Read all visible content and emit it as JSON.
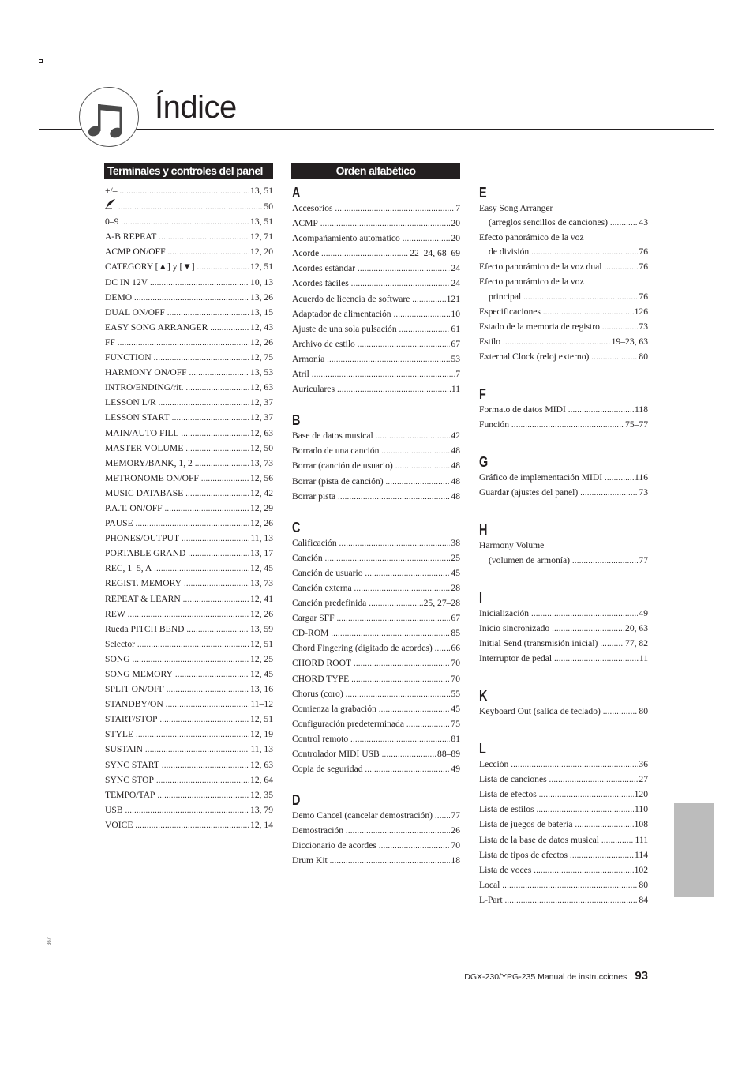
{
  "header": {
    "title": "Índice",
    "icon": "music-note-icon"
  },
  "panel_section": {
    "heading": "Terminales y controles del panel",
    "entries": [
      {
        "term": "+/–",
        "pages": "13, 51"
      },
      {
        "term": "",
        "icon": "quill-pen-icon",
        "pages": "50"
      },
      {
        "term": "0–9",
        "pages": "13, 51"
      },
      {
        "term": "A-B REPEAT",
        "pages": "12, 71"
      },
      {
        "term": "ACMP ON/OFF",
        "pages": "12, 20"
      },
      {
        "term": "CATEGORY [▲] y [▼]",
        "pages": "12, 51"
      },
      {
        "term": "DC IN 12V",
        "pages": "10, 13"
      },
      {
        "term": "DEMO",
        "pages": "13, 26"
      },
      {
        "term": "DUAL ON/OFF",
        "pages": "13, 15"
      },
      {
        "term": "EASY SONG ARRANGER",
        "pages": "12, 43"
      },
      {
        "term": "FF",
        "pages": "12, 26"
      },
      {
        "term": "FUNCTION",
        "pages": "12, 75"
      },
      {
        "term": "HARMONY ON/OFF",
        "pages": "13, 53"
      },
      {
        "term": "INTRO/ENDING/rit.",
        "pages": "12, 63"
      },
      {
        "term": "LESSON L/R",
        "pages": "12, 37"
      },
      {
        "term": "LESSON START",
        "pages": "12, 37"
      },
      {
        "term": "MAIN/AUTO FILL",
        "pages": "12, 63"
      },
      {
        "term": "MASTER VOLUME",
        "pages": "12, 50"
      },
      {
        "term": "MEMORY/BANK, 1, 2",
        "pages": "13, 73"
      },
      {
        "term": "METRONOME ON/OFF",
        "pages": "12, 56"
      },
      {
        "term": "MUSIC DATABASE",
        "pages": "12, 42"
      },
      {
        "term": "P.A.T. ON/OFF",
        "pages": "12, 29"
      },
      {
        "term": "PAUSE",
        "pages": "12, 26"
      },
      {
        "term": "PHONES/OUTPUT",
        "pages": "11, 13"
      },
      {
        "term": "PORTABLE GRAND",
        "pages": "13, 17"
      },
      {
        "term": "REC, 1–5, A",
        "pages": "12, 45"
      },
      {
        "term": "REGIST. MEMORY",
        "pages": "13, 73"
      },
      {
        "term": "REPEAT & LEARN",
        "pages": "12, 41"
      },
      {
        "term": "REW",
        "pages": "12, 26"
      },
      {
        "term": "Rueda PITCH BEND",
        "pages": "13, 59"
      },
      {
        "term": "Selector",
        "pages": "12, 51"
      },
      {
        "term": "SONG",
        "pages": "12, 25"
      },
      {
        "term": "SONG MEMORY",
        "pages": "12, 45"
      },
      {
        "term": "SPLIT ON/OFF",
        "pages": "13, 16"
      },
      {
        "term": "STANDBY/ON",
        "pages": "11–12"
      },
      {
        "term": "START/STOP",
        "pages": "12, 51"
      },
      {
        "term": "STYLE",
        "pages": "12, 19"
      },
      {
        "term": "SUSTAIN",
        "pages": "11, 13"
      },
      {
        "term": "SYNC START",
        "pages": "12, 63"
      },
      {
        "term": "SYNC STOP",
        "pages": "12, 64"
      },
      {
        "term": "TEMPO/TAP",
        "pages": "12, 35"
      },
      {
        "term": "USB",
        "pages": "13, 79"
      },
      {
        "term": "VOICE",
        "pages": "12, 14"
      }
    ]
  },
  "alpha_section": {
    "heading": "Orden alfabético",
    "groups": [
      {
        "letter": "A",
        "entries": [
          {
            "term": "Accesorios",
            "pages": "7"
          },
          {
            "term": "ACMP",
            "pages": "20"
          },
          {
            "term": "Acompañamiento automático",
            "pages": "20"
          },
          {
            "term": "Acorde",
            "pages": "22–24, 68–69"
          },
          {
            "term": "Acordes estándar",
            "pages": "24"
          },
          {
            "term": "Acordes fáciles",
            "pages": "24"
          },
          {
            "term": "Acuerdo de licencia de software",
            "pages": "121"
          },
          {
            "term": "Adaptador de alimentación",
            "pages": "10"
          },
          {
            "term": "Ajuste de una sola pulsación",
            "pages": "61"
          },
          {
            "term": "Archivo de estilo",
            "pages": "67"
          },
          {
            "term": "Armonía",
            "pages": "53"
          },
          {
            "term": "Atril",
            "pages": "7"
          },
          {
            "term": "Auriculares",
            "pages": "11"
          }
        ]
      },
      {
        "letter": "B",
        "entries": [
          {
            "term": "Base de datos musical",
            "pages": "42"
          },
          {
            "term": "Borrado de una canción",
            "pages": "48"
          },
          {
            "term": "Borrar (canción de usuario)",
            "pages": "48"
          },
          {
            "term": "Borrar (pista de canción)",
            "pages": "48"
          },
          {
            "term": "Borrar pista",
            "pages": "48"
          }
        ]
      },
      {
        "letter": "C",
        "entries": [
          {
            "term": "Calificación",
            "pages": "38"
          },
          {
            "term": "Canción",
            "pages": "25"
          },
          {
            "term": "Canción de usuario",
            "pages": "45"
          },
          {
            "term": "Canción externa",
            "pages": "28"
          },
          {
            "term": "Canción predefinida",
            "pages": "25, 27–28"
          },
          {
            "term": "Cargar SFF",
            "pages": "67"
          },
          {
            "term": "CD-ROM",
            "pages": "85"
          },
          {
            "term": "Chord Fingering (digitado de acordes)",
            "pages": "66"
          },
          {
            "term": "CHORD ROOT",
            "pages": "70"
          },
          {
            "term": "CHORD TYPE",
            "pages": "70"
          },
          {
            "term": "Chorus (coro)",
            "pages": "55"
          },
          {
            "term": "Comienza la grabación",
            "pages": "45"
          },
          {
            "term": "Configuración predeterminada",
            "pages": "75"
          },
          {
            "term": "Control remoto",
            "pages": "81"
          },
          {
            "term": "Controlador MIDI USB",
            "pages": "88–89"
          },
          {
            "term": "Copia de seguridad",
            "pages": "49"
          }
        ]
      },
      {
        "letter": "D",
        "entries": [
          {
            "term": "Demo Cancel (cancelar demostración)",
            "pages": "77"
          },
          {
            "term": "Demostración",
            "pages": "26"
          },
          {
            "term": "Diccionario de acordes",
            "pages": "70"
          },
          {
            "term": "Drum Kit",
            "pages": "18"
          }
        ]
      },
      {
        "letter": "E",
        "entries": [
          {
            "term": "Easy Song Arranger",
            "term2": "(arreglos sencillos de canciones)",
            "pages": "43"
          },
          {
            "term": "Efecto panorámico de la voz",
            "term2": "de división",
            "pages": "76"
          },
          {
            "term": "Efecto panorámico de la voz dual",
            "pages": "76"
          },
          {
            "term": "Efecto panorámico de la voz",
            "term2": "principal",
            "pages": "76"
          },
          {
            "term": "Especificaciones",
            "pages": "126"
          },
          {
            "term": "Estado de la memoria de registro",
            "pages": "73"
          },
          {
            "term": "Estilo",
            "pages": "19–23, 63"
          },
          {
            "term": "External Clock (reloj externo)",
            "pages": "80"
          }
        ]
      },
      {
        "letter": "F",
        "entries": [
          {
            "term": "Formato de datos MIDI",
            "pages": "118"
          },
          {
            "term": "Función",
            "pages": "75–77"
          }
        ]
      },
      {
        "letter": "G",
        "entries": [
          {
            "term": "Gráfico de implementación MIDI",
            "pages": "116"
          },
          {
            "term": "Guardar (ajustes del panel)",
            "pages": "73"
          }
        ]
      },
      {
        "letter": "H",
        "entries": [
          {
            "term": "Harmony Volume",
            "term2": "(volumen de armonía)",
            "pages": "77"
          }
        ]
      },
      {
        "letter": "I",
        "entries": [
          {
            "term": "Inicialización",
            "pages": "49"
          },
          {
            "term": "Inicio sincronizado",
            "pages": "20, 63"
          },
          {
            "term": "Initial Send (transmisión inicial)",
            "pages": "77, 82"
          },
          {
            "term": "Interruptor de pedal",
            "pages": "11"
          }
        ]
      },
      {
        "letter": "K",
        "entries": [
          {
            "term": "Keyboard Out (salida de teclado)",
            "pages": "80"
          }
        ]
      },
      {
        "letter": "L",
        "entries": [
          {
            "term": "Lección",
            "pages": "36"
          },
          {
            "term": "Lista de canciones",
            "pages": "27"
          },
          {
            "term": "Lista de efectos",
            "pages": "120"
          },
          {
            "term": "Lista de estilos",
            "pages": "110"
          },
          {
            "term": "Lista de juegos de batería",
            "pages": "108"
          },
          {
            "term": "Lista de la base de datos musical",
            "pages": "111"
          },
          {
            "term": "Lista de tipos de efectos",
            "pages": "114"
          },
          {
            "term": "Lista de voces",
            "pages": "102"
          },
          {
            "term": "Local",
            "pages": "80"
          },
          {
            "term": "L-Part",
            "pages": "84"
          }
        ]
      }
    ]
  },
  "footer": {
    "manual_name": "DGX-230/YPG-235  Manual de instrucciones",
    "page_number": "93",
    "side_code": "367"
  },
  "colors": {
    "text": "#231f20",
    "heading_bar": "#231f20",
    "side_tab": "#bcbcbc"
  }
}
